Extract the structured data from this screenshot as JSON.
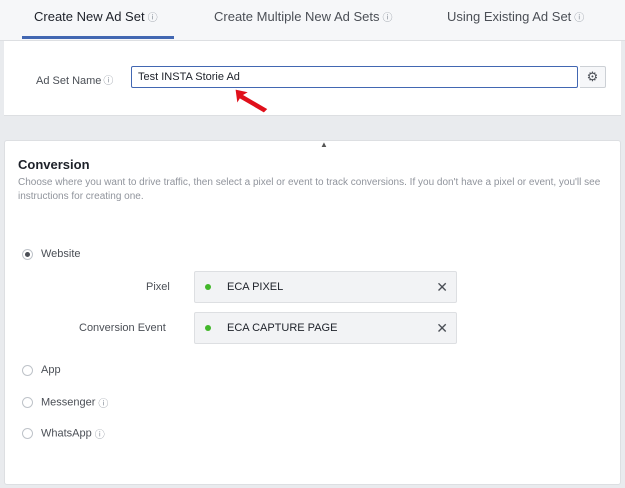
{
  "tabs": [
    {
      "label": "Create New Ad Set"
    },
    {
      "label": "Create Multiple New Ad Sets"
    },
    {
      "label": "Using Existing Ad Set"
    }
  ],
  "ad_set_name": {
    "label": "Ad Set Name",
    "value": "Test INSTA Storie Ad"
  },
  "conversion": {
    "title": "Conversion",
    "description": "Choose where you want to drive traffic, then select a pixel or event to track conversions. If you don't have a pixel or event, you'll see instructions for creating one.",
    "options": [
      {
        "label": "Website",
        "selected": true
      },
      {
        "label": "App",
        "selected": false
      },
      {
        "label": "Messenger",
        "selected": false
      },
      {
        "label": "WhatsApp",
        "selected": false
      }
    ],
    "pixel": {
      "label": "Pixel",
      "value": "ECA PIXEL",
      "status_color": "#42b72a"
    },
    "event": {
      "label": "Conversion Event",
      "value": "ECA CAPTURE PAGE",
      "status_color": "#42b72a"
    }
  },
  "colors": {
    "accent": "#4267b2",
    "annotation_arrow": "#e0101b"
  },
  "icons": {
    "info": "info-icon",
    "settings": "gear-icon",
    "remove": "close-icon"
  }
}
